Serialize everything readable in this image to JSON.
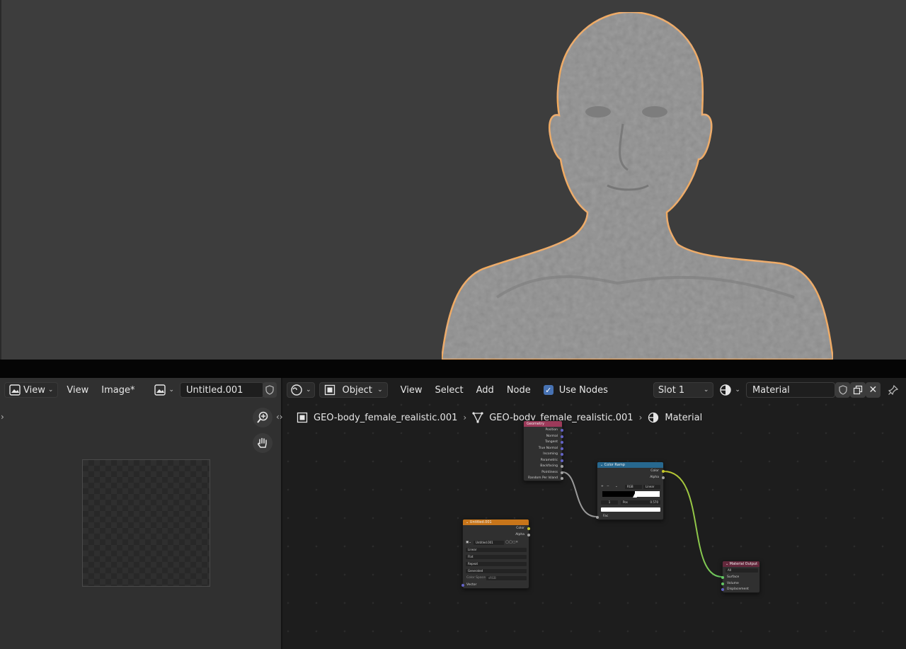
{
  "colors": {
    "selection_outline": "#f7a84a",
    "viewport_bg": "#3d3d3d",
    "node_geometry_header": "#9d3a5a",
    "node_converter_header": "#27688f",
    "node_texture_header": "#c7751a",
    "node_output_header": "#64283c",
    "accent_checkbox": "#4772b3"
  },
  "image_editor": {
    "mode_label": "View",
    "menu_view": "View",
    "menu_image": "Image*",
    "image_name": "Untitled.001",
    "icons": [
      "image-editor-icon",
      "image-icon",
      "shield-icon",
      "zoom-icon",
      "hand-icon"
    ]
  },
  "node_editor": {
    "object_mode": "Object",
    "menus": [
      "View",
      "Select",
      "Add",
      "Node"
    ],
    "use_nodes_label": "Use Nodes",
    "use_nodes_checked": true,
    "slot": "Slot 1",
    "material_name": "Material",
    "breadcrumb": [
      "GEO-body_female_realistic.001",
      "GEO-body_female_realistic.001",
      "Material"
    ]
  },
  "nodes": {
    "geometry": {
      "title": "Geometry",
      "outputs": [
        "Position",
        "Normal",
        "Tangent",
        "True Normal",
        "Incoming",
        "Parametric",
        "Backfacing",
        "Pointiness",
        "Random Per Island"
      ]
    },
    "color_ramp": {
      "title": "Color Ramp",
      "outputs": [
        "Color",
        "Alpha"
      ],
      "color_mode": "RGB",
      "interpolation": "Linear",
      "stop_index": "1",
      "pos_label": "Pos",
      "pos_value": "0.570",
      "input": "Fac"
    },
    "image_texture": {
      "title": "Untitled.001",
      "outputs": [
        "Color",
        "Alpha"
      ],
      "image": "Untitled.001",
      "interpolation": "Linear",
      "projection": "Flat",
      "extension": "Repeat",
      "source": "Generated",
      "color_space_label": "Color Space",
      "color_space": "sRGB",
      "input": "Vector"
    },
    "material_output": {
      "title": "Material Output",
      "target": "All",
      "inputs": [
        "Surface",
        "Volume",
        "Displacement"
      ]
    }
  }
}
